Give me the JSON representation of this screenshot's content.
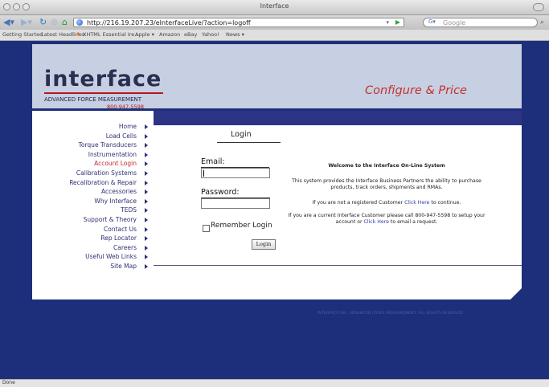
{
  "browser": {
    "window_title": "Interface",
    "url": "http://216.19.207.23/eInterfaceLive/?action=logoff",
    "search_placeholder": "Google",
    "bookmarks": [
      "Getting Started",
      "Latest Headlines",
      "XHTML Essential Ire...",
      "Apple ▾",
      "Amazon",
      "eBay",
      "Yahoo!",
      "News ▾"
    ],
    "status": "Done"
  },
  "header": {
    "logo_word": "interface",
    "logo_subtitle": "ADVANCED FORCE MEASUREMENT",
    "phone": "800-947-5598",
    "tagline": "Configure & Price"
  },
  "menu": [
    {
      "label": "Home",
      "active": false
    },
    {
      "label": "Load Cells",
      "active": false
    },
    {
      "label": "Torque Transducers",
      "active": false
    },
    {
      "label": "Instrumentation",
      "active": false
    },
    {
      "label": "Account Login",
      "active": true
    },
    {
      "label": "Calibration Systems",
      "active": false
    },
    {
      "label": "Recalibration & Repair",
      "active": false
    },
    {
      "label": "Accessories",
      "active": false
    },
    {
      "label": "Why Interface",
      "active": false
    },
    {
      "label": "TEDS",
      "active": false
    },
    {
      "label": "Support & Theory",
      "active": false
    },
    {
      "label": "Contact Us",
      "active": false
    },
    {
      "label": "Rep Locator",
      "active": false
    },
    {
      "label": "Careers",
      "active": false
    },
    {
      "label": "Useful Web Links",
      "active": false
    },
    {
      "label": "Site Map",
      "active": false
    }
  ],
  "login": {
    "title": "Login",
    "email_label": "Email:",
    "email_value": "",
    "password_label": "Password:",
    "password_value": "",
    "remember_label": "Remember Login",
    "remember_checked": false,
    "button_label": "Login"
  },
  "welcome": {
    "heading": "Welcome to the Interface On-Line System",
    "intro": "This system provides the Interface Business Partners the ability to purchase products, track orders, shipments and RMAs.",
    "not_registered_pre": "If you are not a registered Customer ",
    "click_here": "Click Here",
    "not_registered_post": " to continue.",
    "current_pre": "If you are a current  Interface Customer please call 800-947-5598 to setup your account or  ",
    "current_post": " to email a request."
  },
  "footer": "INTERFACE INC. ADVANCED FORCE MEASUREMENT.  ALL RIGHTS RESERVED"
}
